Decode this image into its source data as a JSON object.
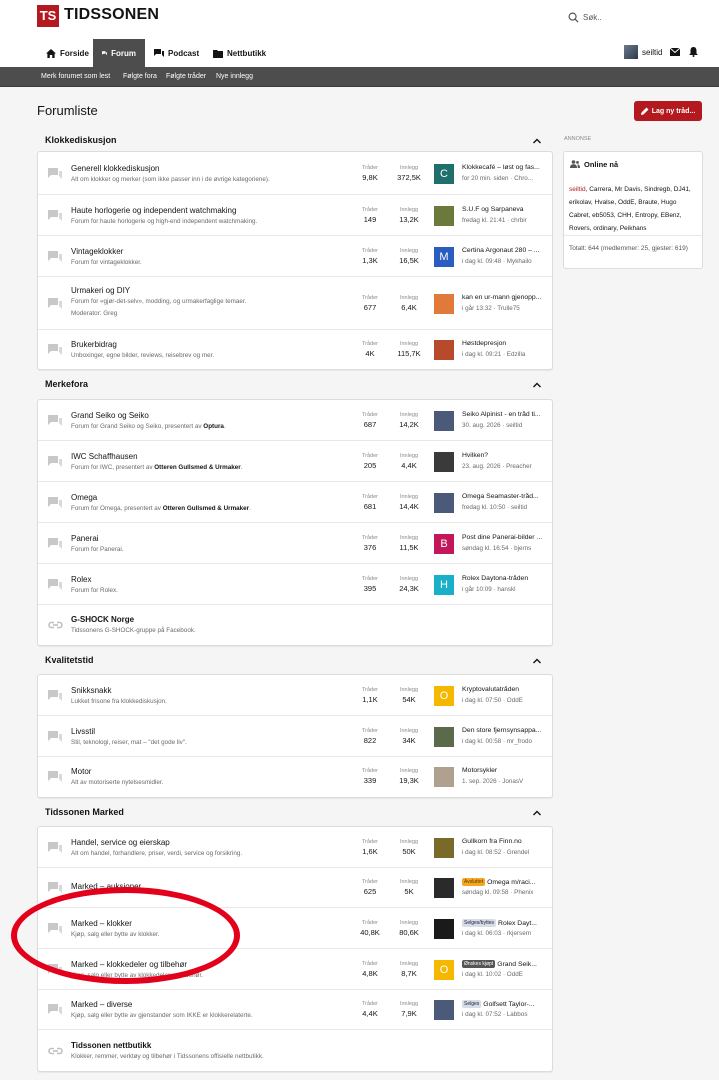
{
  "site": {
    "logo_abbr": "TS",
    "logo_text": "TIDSSONEN",
    "search_placeholder": "Søk.."
  },
  "nav": {
    "forside": "Forside",
    "forum": "Forum",
    "podcast": "Podcast",
    "nettbutikk": "Nettbutikk"
  },
  "user": {
    "name": "seiltid"
  },
  "subnav": [
    "Merk forumet som lest",
    "Følgte fora",
    "Følgte tråder",
    "Nye innlegg"
  ],
  "page": {
    "title": "Forumliste",
    "new_thread": "Lag ny tråd..."
  },
  "labels": {
    "threads": "Tråder",
    "posts": "Innlegg"
  },
  "categories": [
    {
      "title": "Klokkediskusjon",
      "forums": [
        {
          "title": "Generell klokkediskusjon",
          "desc": "Alt om klokker og merker (som ikke passer inn i de øvrige kategoriene).",
          "threads": "9,8K",
          "posts": "372,5K",
          "last_title": "Klokkecafé – løst og fas...",
          "last_meta": "for 20 min. siden · Chro...",
          "thumb_letter": "C",
          "thumb_color": "#1f6f6b"
        },
        {
          "title": "Haute horlogerie og independent watchmaking",
          "desc": "Forum for haute horlogerie og high-end independent watchmaking.",
          "threads": "149",
          "posts": "13,2K",
          "last_title": "S.U.F og Sarpaneva",
          "last_meta": "fredag kl. 21:41 · chrbir",
          "thumb_letter": "",
          "thumb_color": "#6b7a3a"
        },
        {
          "title": "Vintageklokker",
          "desc": "Forum for vintageklokker.",
          "threads": "1,3K",
          "posts": "16,5K",
          "last_title": "Certina Argonaut 280 – ...",
          "last_meta": "i dag kl. 09:48 · Mykhailo",
          "thumb_letter": "M",
          "thumb_color": "#2a5dbf"
        },
        {
          "title": "Urmakeri og DIY",
          "desc": "Forum for «gjør-det-selv», modding, og urmakerfaglige temaer.",
          "mod": "Moderator: Greg",
          "threads": "677",
          "posts": "6,4K",
          "last_title": "kan en ur-mann gjenopp...",
          "last_meta": "i går 13:32 · Trulle75",
          "thumb_letter": "",
          "thumb_color": "#e07a3a"
        },
        {
          "title": "Brukerbidrag",
          "desc": "Unboxinger, egne bilder, reviews, reisebrev og mer.",
          "threads": "4K",
          "posts": "115,7K",
          "last_title": "Høstdepresjon",
          "last_meta": "i dag kl. 09:21 · Edzilla",
          "thumb_letter": "",
          "thumb_color": "#b84a2c"
        }
      ]
    },
    {
      "title": "Merkefora",
      "forums": [
        {
          "title": "Grand Seiko og Seiko",
          "desc_pre": "Forum for Grand Seiko og Seiko, presentert av ",
          "desc_bold": "Optura",
          "desc_post": ".",
          "threads": "687",
          "posts": "14,2K",
          "last_title": "Seiko Alpinist - en tråd ti...",
          "last_meta": "30. aug. 2026 · seiltid",
          "thumb_letter": "",
          "thumb_color": "#4a5a78"
        },
        {
          "title": "IWC Schaffhausen",
          "desc_pre": "Forum for IWC, presentert av ",
          "desc_bold": "Otteren Gullsmed & Urmaker",
          "desc_post": ".",
          "threads": "205",
          "posts": "4,4K",
          "last_title": "Hvilken?",
          "last_meta": "23. aug. 2026 · Preacher",
          "thumb_letter": "",
          "thumb_color": "#3a3a3a"
        },
        {
          "title": "Omega",
          "desc_pre": "Forum for Omega, presentert av ",
          "desc_bold": "Otteren Gullsmed & Urmaker",
          "desc_post": ".",
          "threads": "681",
          "posts": "14,4K",
          "last_title": "Omega Seamaster-tråd...",
          "last_meta": "fredag kl. 10:50 · seiltid",
          "thumb_letter": "",
          "thumb_color": "#4a5a78"
        },
        {
          "title": "Panerai",
          "desc_pre": "Forum for Panerai.",
          "desc_bold": "",
          "desc_post": "",
          "threads": "376",
          "posts": "11,5K",
          "last_title": "Post dine Panerai-bilder ...",
          "last_meta": "søndag kl. 16:54 · bjerns",
          "thumb_letter": "B",
          "thumb_color": "#c2185b"
        },
        {
          "title": "Rolex",
          "desc_pre": "Forum for Rolex.",
          "desc_bold": "",
          "desc_post": "",
          "threads": "395",
          "posts": "24,3K",
          "last_title": "Rolex Daytona-tråden",
          "last_meta": "i går 10:09 · hanskl",
          "thumb_letter": "H",
          "thumb_color": "#1ab0c8"
        },
        {
          "title": "G-SHOCK Norge",
          "desc_pre": "Tidssonens G-SHOCK-gruppe på Facebook.",
          "desc_bold": "",
          "desc_post": "",
          "link": true
        }
      ]
    },
    {
      "title": "Kvalitetstid",
      "forums": [
        {
          "title": "Snikksnakk",
          "desc": "Lukket frisone fra klokkediskusjon.",
          "threads": "1,1K",
          "posts": "54K",
          "last_title": "Kryptovalutatråden",
          "last_meta": "i dag kl. 07:50 · OddE",
          "thumb_letter": "O",
          "thumb_color": "#f5b800"
        },
        {
          "title": "Livsstil",
          "desc": "Stil, teknologi, reiser, mat – \"det gode liv\".",
          "threads": "822",
          "posts": "34K",
          "last_title": "Den store fjernsynsappa...",
          "last_meta": "i dag kl. 00:58 · mr_frodo",
          "thumb_letter": "",
          "thumb_color": "#5a6a4a"
        },
        {
          "title": "Motor",
          "desc": "Alt av motoriserte nytelsesmidler.",
          "threads": "339",
          "posts": "19,3K",
          "last_title": "Motorsykler",
          "last_meta": "1. sep. 2026 · JonasV",
          "thumb_letter": "",
          "thumb_color": "#b0a090"
        }
      ]
    },
    {
      "title": "Tidssonen Marked",
      "forums": [
        {
          "title": "Handel, service og eierskap",
          "desc": "Alt om handel, forhandlere, priser, verdi, service og forsikring.",
          "threads": "1,6K",
          "posts": "50K",
          "last_title": "Gullkorn fra Finn.no",
          "last_meta": "i dag kl. 08:52 · Grendel",
          "thumb_letter": "",
          "thumb_color": "#7a6a2a"
        },
        {
          "title": "Marked – auksjoner",
          "desc": "",
          "threads": "625",
          "posts": "5K",
          "badge": "Avsluttet",
          "badge_bg": "#f5a623",
          "badge_fg": "#5a3a00",
          "last_title": "Omega m/raci...",
          "last_meta": "søndag kl. 09:58 · Phenix",
          "thumb_letter": "",
          "thumb_color": "#2a2a2a"
        },
        {
          "title": "Marked – klokker",
          "desc": "Kjøp, salg eller bytte av klokker.",
          "threads": "40,8K",
          "posts": "80,6K",
          "badge": "Selges/byttes",
          "badge_bg": "#d7dde8",
          "badge_fg": "#223",
          "last_title": "Rolex Dayt...",
          "last_meta": "i dag kl. 06:03 · rkjersem",
          "thumb_letter": "",
          "thumb_color": "#1a1a1a"
        },
        {
          "title": "Marked – klokkedeler og tilbehør",
          "desc": "Kjøp, salg eller bytte av klokkedeler og tilbehør.",
          "threads": "4,8K",
          "posts": "8,7K",
          "badge": "Ønskes kjøpt",
          "badge_bg": "#555",
          "badge_fg": "#fff",
          "last_title": "Grand Seik...",
          "last_meta": "i dag kl. 10:02 · OddE",
          "thumb_letter": "O",
          "thumb_color": "#f5b800"
        },
        {
          "title": "Marked – diverse",
          "desc": "Kjøp, salg eller bytte av gjenstander som IKKE er klokkerelaterte.",
          "threads": "4,4K",
          "posts": "7,9K",
          "badge": "Selges",
          "badge_bg": "#d7dde8",
          "badge_fg": "#223",
          "last_title": "Golfsett Taylor-...",
          "last_meta": "i dag kl. 07:52 · Labbos",
          "thumb_letter": "",
          "thumb_color": "#4a5a78"
        },
        {
          "title": "Tidssonen nettbutikk",
          "desc": "Klokker, remmer, verktøy og tilbehør i Tidssonens offisielle nettbutikk.",
          "link": true
        }
      ]
    }
  ],
  "sidebar": {
    "ad_label": "ANNONSE",
    "online_title": "Online nå",
    "online_me": "seiltid",
    "online_rest": ", Carrera, Mr Davis, Sindregb, DJ41, erikolav, Hvalse, OddE, Braute, Hugo Cabret, eb5053, CHH, Entropy, EBenz, Rovers, ordinary, Peikhans",
    "online_total": "Totalt: 644 (medlemmer: 25, gjester: 619)"
  }
}
